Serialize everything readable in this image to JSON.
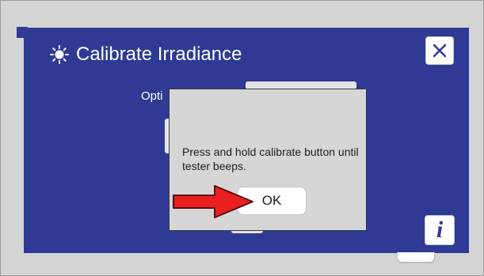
{
  "dialog": {
    "title": "Calibrate Irradiance",
    "title_icon": "sun-icon",
    "close_icon": "close-x-icon",
    "info_label": "i",
    "option_label_partial": "Opti",
    "background_color": "#2e3a94"
  },
  "modal": {
    "message": "Press and hold calibrate button until tester beeps.",
    "ok_label": "OK"
  },
  "annotation": {
    "icon": "red-arrow-icon",
    "color": "#e8201f"
  }
}
